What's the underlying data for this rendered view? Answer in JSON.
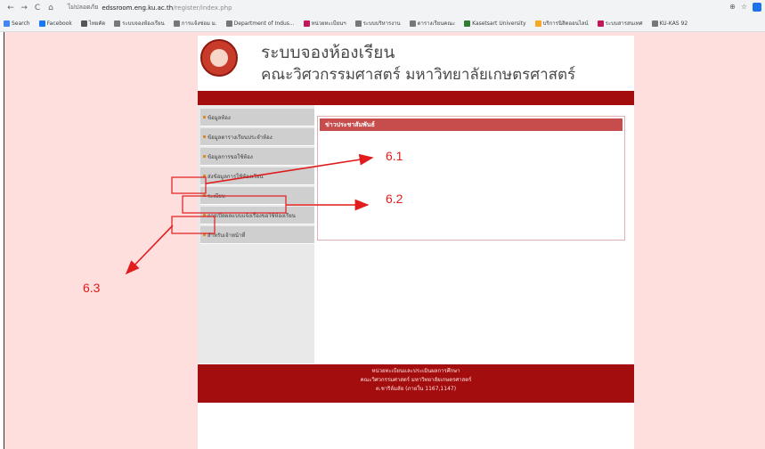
{
  "browser": {
    "back": "←",
    "forward": "→",
    "reload": "C",
    "home": "⌂",
    "security": "ไม่ปลอดภัย",
    "domain": "edssroom.eng.ku.ac.th",
    "path": "/register/index.php",
    "bookmarks": [
      {
        "label": "Search",
        "color": "#4285f4"
      },
      {
        "label": "Facebook",
        "color": "#1877f2"
      },
      {
        "label": "ไทยคัด",
        "color": "#555555"
      },
      {
        "label": "ระบบจองห้องเรียน",
        "color": "#777777"
      },
      {
        "label": "การแจ้งซ่อม ม.",
        "color": "#777777"
      },
      {
        "label": "Department of Indus...",
        "color": "#777777"
      },
      {
        "label": "หน่วยทะเบียนฯ",
        "color": "#c2185b"
      },
      {
        "label": "ระบบบริหารงาน",
        "color": "#777777"
      },
      {
        "label": "ตารางเรียนคณะ",
        "color": "#777777"
      },
      {
        "label": "Kasetsart University",
        "color": "#2e7d32"
      },
      {
        "label": "บริการนิสิตออนไลน์",
        "color": "#f9a825"
      },
      {
        "label": "ระบบสารสนเทศ",
        "color": "#c2185b"
      },
      {
        "label": "KU-KAS 92",
        "color": "#777777"
      }
    ]
  },
  "site": {
    "title_line1": "ระบบจองห้องเรียน",
    "title_line2": "คณะวิศวกรรมศาสตร์ มหาวิทยาลัยเกษตรศาสตร์",
    "menu": [
      "ข้อมูลห้อง",
      "ข้อมูลตารางเรียนประจำห้อง",
      "ข้อมูลการขอใช้ห้อง",
      "ส่งข้อมูลการใช้ห้องเรียน",
      "ระเบียบ",
      "การเปิดผลแบบแจ้งเรื่องขอใช้ห้องเรียน",
      "สำหรับเจ้าหน้าที่"
    ],
    "news_title": "ข่าวประชาสัมพันธ์",
    "footer": {
      "line1": "หน่วยทะเบียนและประเมินผลการศึกษา",
      "line2": "คณะวิศวกรรมศาสตร์ มหาวิทยาลัยเกษตรศาสตร์",
      "line3": "ต.ชาริล์มลัย (ภายใน 1167,1147)"
    }
  },
  "annotations": {
    "label_6_1": "6.1",
    "label_6_2": "6.2",
    "label_6_3": "6.3",
    "color": "#e01c1c"
  }
}
